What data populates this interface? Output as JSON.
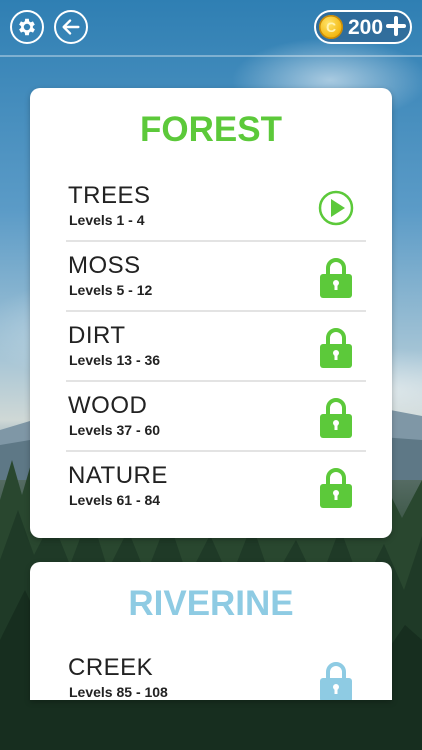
{
  "header": {
    "coins": "200",
    "coin_symbol": "C"
  },
  "sections": [
    {
      "title": "FOREST",
      "title_color": "#5cc93a",
      "levels": [
        {
          "name": "TREES",
          "range": "Levels 1 - 4",
          "state": "play-icon"
        },
        {
          "name": "MOSS",
          "range": "Levels 5 - 12",
          "state": "lock-icon"
        },
        {
          "name": "DIRT",
          "range": "Levels 13 - 36",
          "state": "lock-icon"
        },
        {
          "name": "WOOD",
          "range": "Levels 37 - 60",
          "state": "lock-icon"
        },
        {
          "name": "NATURE",
          "range": "Levels 61 - 84",
          "state": "lock-icon"
        }
      ]
    },
    {
      "title": "RIVERINE",
      "title_color": "#8ecbe3",
      "levels": [
        {
          "name": "CREEK",
          "range": "Levels 85 - 108",
          "state": "lock-icon"
        }
      ]
    }
  ],
  "colors": {
    "forest_accent": "#5cc93a",
    "riverine_accent": "#8ecbe3",
    "coin_gold": "#f3b812"
  }
}
